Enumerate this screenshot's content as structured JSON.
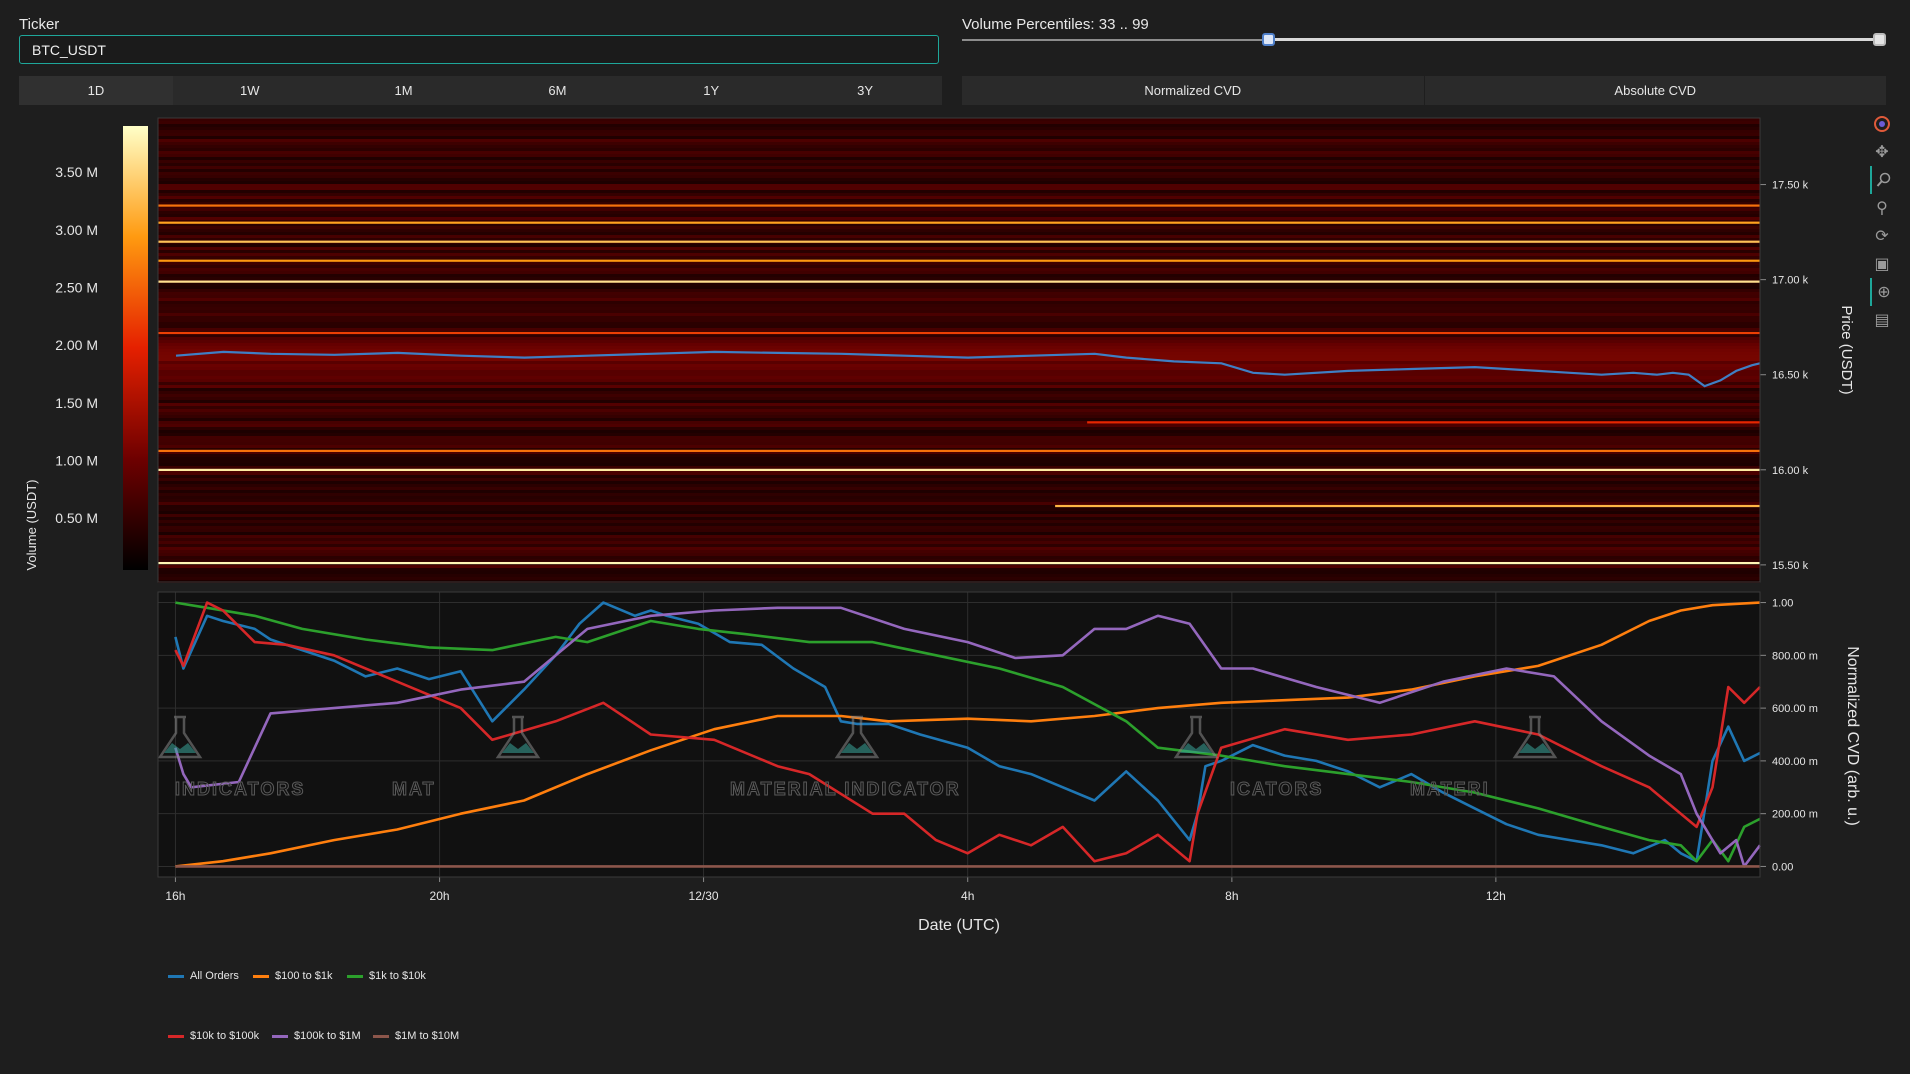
{
  "ticker": {
    "label": "Ticker",
    "value": "BTC_USDT"
  },
  "volume_slider": {
    "label": "Volume Percentiles: 33 .. 99",
    "low": 33,
    "high": 99,
    "min": 0,
    "max": 100
  },
  "timeframes": [
    {
      "label": "1D",
      "active": true
    },
    {
      "label": "1W",
      "active": false
    },
    {
      "label": "1M",
      "active": false
    },
    {
      "label": "6M",
      "active": false
    },
    {
      "label": "1Y",
      "active": false
    },
    {
      "label": "3Y",
      "active": false
    }
  ],
  "cvd_modes": [
    {
      "label": "Normalized CVD"
    },
    {
      "label": "Absolute CVD"
    }
  ],
  "modebar_icons": [
    "plotly-logo-icon",
    "pan-icon",
    "zoom-icon",
    "zoom-in-out-icon",
    "reset-axes-icon",
    "download-icon",
    "spike-lines-icon",
    "hover-icon"
  ],
  "watermark": {
    "text_fragments": [
      "INDICATORS",
      "MAT",
      "MATERIAL INDICATOR",
      "ICATORS",
      "MATERI"
    ]
  },
  "colors": {
    "all_orders": "#1f77b4",
    "r100_1k": "#ff7f0e",
    "r1k_10k": "#2ca02c",
    "r10k_100k": "#d62728",
    "r100k_1m": "#9467bd",
    "r1m_10m": "#8c564b",
    "price_line": "#3f7fc4",
    "accent": "#1ea79a"
  },
  "chart_data": [
    {
      "type": "heatmap",
      "title": "",
      "ylabel": "Price (USDT)",
      "colorbar_label": "Volume (USDT)",
      "colorbar_ticks": [
        "0.50 M",
        "1.00 M",
        "1.50 M",
        "2.00 M",
        "2.50 M",
        "3.00 M",
        "3.50 M"
      ],
      "colorbar_values": [
        0.5,
        1.0,
        1.5,
        2.0,
        2.5,
        3.0,
        3.5
      ],
      "colorbar_range": [
        0.05,
        3.9
      ],
      "y_ticks": [
        "15.50 k",
        "16.00 k",
        "16.50 k",
        "17.00 k",
        "17.50 k"
      ],
      "y_tick_values": [
        15500,
        16000,
        16500,
        17000,
        17500
      ],
      "ylim": [
        15410,
        17850
      ],
      "bright_levels": [
        {
          "price": 15510,
          "volume": 3.8,
          "start": 0
        },
        {
          "price": 15810,
          "volume": 3.2,
          "start": 0.56
        },
        {
          "price": 16000,
          "volume": 3.7,
          "start": 0
        },
        {
          "price": 16100,
          "volume": 2.6,
          "start": 0
        },
        {
          "price": 16250,
          "volume": 2.0,
          "start": 0.58
        },
        {
          "price": 16720,
          "volume": 2.2,
          "start": 0
        },
        {
          "price": 16990,
          "volume": 3.6,
          "start": 0
        },
        {
          "price": 17100,
          "volume": 2.9,
          "start": 0
        },
        {
          "price": 17200,
          "volume": 3.3,
          "start": 0
        },
        {
          "price": 17300,
          "volume": 3.0,
          "start": 0
        },
        {
          "price": 17390,
          "volume": 2.6,
          "start": 0
        }
      ],
      "price_series": {
        "name": "Price",
        "x": [
          0,
          0.03,
          0.06,
          0.1,
          0.14,
          0.18,
          0.22,
          0.26,
          0.3,
          0.34,
          0.38,
          0.42,
          0.46,
          0.5,
          0.54,
          0.58,
          0.6,
          0.63,
          0.66,
          0.68,
          0.7,
          0.74,
          0.78,
          0.82,
          0.86,
          0.88,
          0.9,
          0.92,
          0.935,
          0.945,
          0.955,
          0.965,
          0.975,
          0.985,
          0.995,
          1.0
        ],
        "y": [
          16600,
          16620,
          16610,
          16605,
          16615,
          16600,
          16590,
          16600,
          16610,
          16620,
          16615,
          16610,
          16600,
          16590,
          16600,
          16610,
          16590,
          16570,
          16560,
          16510,
          16500,
          16520,
          16530,
          16540,
          16520,
          16510,
          16500,
          16510,
          16500,
          16510,
          16500,
          16440,
          16470,
          16520,
          16550,
          16560
        ]
      }
    },
    {
      "type": "line",
      "xlabel": "Date (UTC)",
      "ylabel": "Normalized CVD (arb. u.)",
      "x_ticks": [
        "16h",
        "20h",
        "12/30",
        "4h",
        "8h",
        "12h"
      ],
      "x_tick_values": [
        0,
        0.1667,
        0.3333,
        0.5,
        0.6667,
        0.8333
      ],
      "y_ticks": [
        "0.00",
        "200.00 m",
        "400.00 m",
        "600.00 m",
        "800.00 m",
        "1.00"
      ],
      "y_tick_values": [
        0,
        0.2,
        0.4,
        0.6,
        0.8,
        1.0
      ],
      "ylim": [
        -0.04,
        1.04
      ],
      "xlim": [
        -0.011,
        1.0
      ],
      "series": [
        {
          "name": "All Orders",
          "color": "#1f77b4",
          "x": [
            0,
            0.005,
            0.02,
            0.03,
            0.05,
            0.06,
            0.08,
            0.1,
            0.12,
            0.14,
            0.16,
            0.18,
            0.2,
            0.22,
            0.24,
            0.255,
            0.27,
            0.29,
            0.3,
            0.31,
            0.33,
            0.35,
            0.37,
            0.39,
            0.41,
            0.42,
            0.43,
            0.45,
            0.47,
            0.5,
            0.52,
            0.54,
            0.56,
            0.58,
            0.6,
            0.62,
            0.64,
            0.645,
            0.65,
            0.66,
            0.68,
            0.7,
            0.72,
            0.74,
            0.76,
            0.78,
            0.8,
            0.82,
            0.84,
            0.86,
            0.88,
            0.9,
            0.92,
            0.94,
            0.95,
            0.96,
            0.97,
            0.98,
            0.99,
            1.0
          ],
          "y": [
            0.87,
            0.75,
            0.95,
            0.93,
            0.9,
            0.86,
            0.82,
            0.78,
            0.72,
            0.75,
            0.71,
            0.74,
            0.55,
            0.67,
            0.8,
            0.92,
            1.0,
            0.95,
            0.97,
            0.95,
            0.92,
            0.85,
            0.84,
            0.75,
            0.68,
            0.55,
            0.54,
            0.54,
            0.5,
            0.45,
            0.38,
            0.35,
            0.3,
            0.25,
            0.36,
            0.25,
            0.1,
            0.2,
            0.38,
            0.4,
            0.46,
            0.42,
            0.4,
            0.36,
            0.3,
            0.35,
            0.28,
            0.22,
            0.16,
            0.12,
            0.1,
            0.08,
            0.05,
            0.1,
            0.05,
            0.02,
            0.4,
            0.53,
            0.4,
            0.43
          ]
        },
        {
          "name": "$100 to $1k",
          "color": "#ff7f0e",
          "x": [
            0,
            0.03,
            0.06,
            0.1,
            0.14,
            0.18,
            0.22,
            0.26,
            0.3,
            0.34,
            0.38,
            0.42,
            0.45,
            0.5,
            0.54,
            0.58,
            0.62,
            0.66,
            0.7,
            0.74,
            0.78,
            0.82,
            0.86,
            0.9,
            0.93,
            0.95,
            0.97,
            1.0
          ],
          "y": [
            0.0,
            0.02,
            0.05,
            0.1,
            0.14,
            0.2,
            0.25,
            0.35,
            0.44,
            0.52,
            0.57,
            0.57,
            0.55,
            0.56,
            0.55,
            0.57,
            0.6,
            0.62,
            0.63,
            0.64,
            0.67,
            0.72,
            0.76,
            0.84,
            0.93,
            0.97,
            0.99,
            1.0
          ]
        },
        {
          "name": "$1k to $10k",
          "color": "#2ca02c",
          "x": [
            0,
            0.02,
            0.05,
            0.08,
            0.12,
            0.16,
            0.2,
            0.24,
            0.26,
            0.3,
            0.33,
            0.36,
            0.4,
            0.44,
            0.48,
            0.52,
            0.56,
            0.6,
            0.62,
            0.66,
            0.7,
            0.74,
            0.78,
            0.82,
            0.86,
            0.9,
            0.93,
            0.95,
            0.96,
            0.97,
            0.98,
            0.99,
            1.0
          ],
          "y": [
            1.0,
            0.98,
            0.95,
            0.9,
            0.86,
            0.83,
            0.82,
            0.87,
            0.85,
            0.93,
            0.9,
            0.88,
            0.85,
            0.85,
            0.8,
            0.75,
            0.68,
            0.55,
            0.45,
            0.42,
            0.38,
            0.35,
            0.32,
            0.28,
            0.22,
            0.15,
            0.1,
            0.08,
            0.02,
            0.1,
            0.02,
            0.15,
            0.18
          ]
        },
        {
          "name": "$10k to $100k",
          "color": "#d62728",
          "x": [
            0,
            0.005,
            0.02,
            0.03,
            0.05,
            0.07,
            0.1,
            0.14,
            0.18,
            0.2,
            0.24,
            0.27,
            0.3,
            0.34,
            0.38,
            0.4,
            0.44,
            0.46,
            0.48,
            0.5,
            0.52,
            0.54,
            0.56,
            0.58,
            0.6,
            0.62,
            0.64,
            0.645,
            0.66,
            0.7,
            0.74,
            0.78,
            0.82,
            0.86,
            0.9,
            0.93,
            0.95,
            0.96,
            0.97,
            0.98,
            0.99,
            1.0
          ],
          "y": [
            0.82,
            0.76,
            1.0,
            0.97,
            0.85,
            0.84,
            0.8,
            0.7,
            0.6,
            0.48,
            0.55,
            0.62,
            0.5,
            0.48,
            0.38,
            0.35,
            0.2,
            0.2,
            0.1,
            0.05,
            0.12,
            0.08,
            0.15,
            0.02,
            0.05,
            0.12,
            0.02,
            0.2,
            0.45,
            0.52,
            0.48,
            0.5,
            0.55,
            0.5,
            0.38,
            0.3,
            0.2,
            0.15,
            0.3,
            0.68,
            0.62,
            0.68
          ]
        },
        {
          "name": "$100k to $1M",
          "color": "#9467bd",
          "x": [
            0,
            0.005,
            0.01,
            0.04,
            0.06,
            0.1,
            0.14,
            0.18,
            0.22,
            0.26,
            0.3,
            0.34,
            0.38,
            0.42,
            0.46,
            0.5,
            0.53,
            0.56,
            0.58,
            0.6,
            0.62,
            0.64,
            0.66,
            0.68,
            0.72,
            0.76,
            0.8,
            0.84,
            0.87,
            0.9,
            0.93,
            0.95,
            0.96,
            0.975,
            0.985,
            0.99,
            1.0
          ],
          "y": [
            0.45,
            0.35,
            0.3,
            0.32,
            0.58,
            0.6,
            0.62,
            0.67,
            0.7,
            0.9,
            0.95,
            0.97,
            0.98,
            0.98,
            0.9,
            0.85,
            0.79,
            0.8,
            0.9,
            0.9,
            0.95,
            0.92,
            0.75,
            0.75,
            0.68,
            0.62,
            0.7,
            0.75,
            0.72,
            0.55,
            0.42,
            0.35,
            0.2,
            0.05,
            0.1,
            0.0,
            0.08
          ]
        },
        {
          "name": "$1M to $10M",
          "color": "#8c564b",
          "x": [
            0,
            1.0
          ],
          "y": [
            0.0,
            0.0
          ]
        }
      ]
    }
  ]
}
